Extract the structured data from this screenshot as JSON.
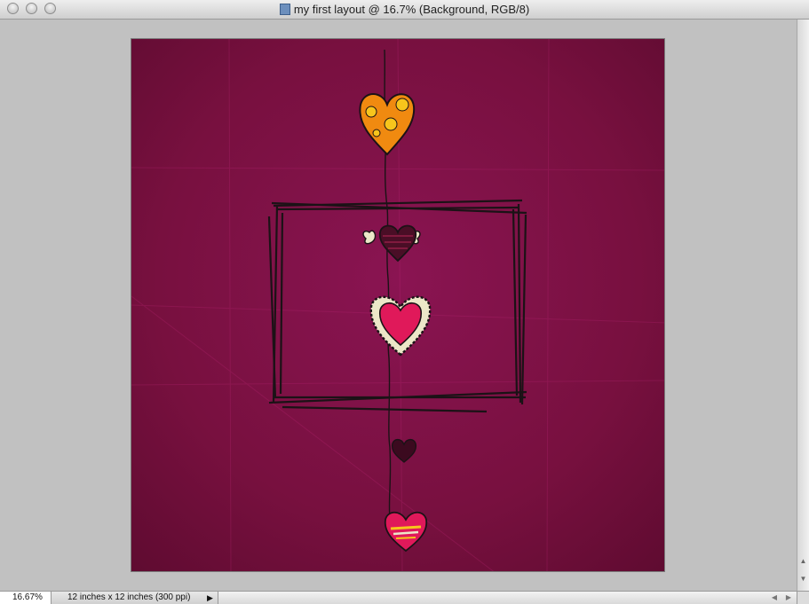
{
  "window": {
    "title": "my first layout @ 16.7% (Background, RGB/8)",
    "title_icon": "photoshop-document-icon"
  },
  "colors": {
    "workspace": "#c1c1c1",
    "paper": "#7a1040",
    "frame_ink": "#1b1216",
    "heart_pink": "#e0195a",
    "heart_orange": "#f08a10",
    "heart_dots": "#f7c51c",
    "cream": "#ece7c8"
  },
  "status": {
    "zoom": "16.67%",
    "doc_info": "12 inches x 12 inches (300 ppi)"
  },
  "icons": {
    "status_menu": "triangle-right-icon",
    "scroll_up": "arrow-up-icon",
    "scroll_down": "arrow-down-icon",
    "scroll_left": "arrow-left-icon",
    "scroll_right": "arrow-right-icon"
  }
}
